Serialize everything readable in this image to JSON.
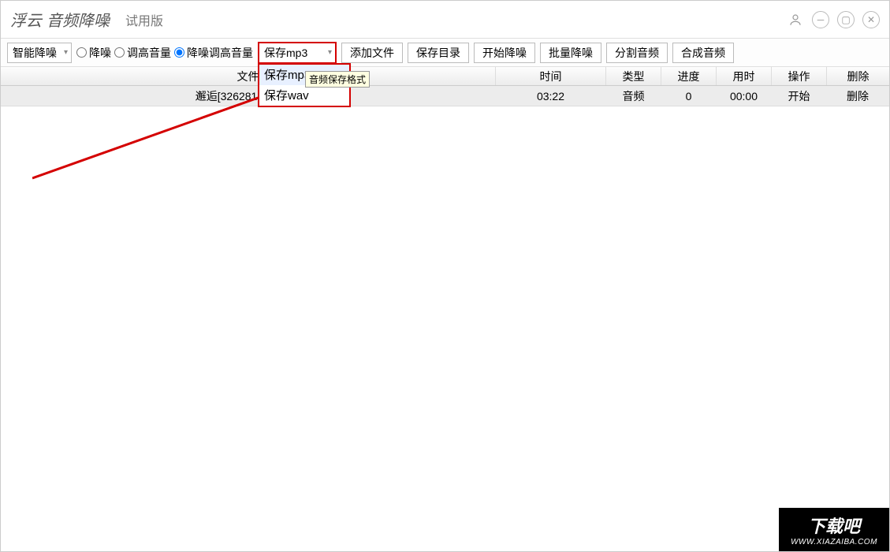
{
  "titlebar": {
    "logo": "浮云",
    "appName": "音频降噪",
    "edition": "试用版"
  },
  "toolbar": {
    "modeSelect": "智能降噪",
    "radios": {
      "r1": "降噪",
      "r2": "调高音量",
      "r3": "降噪调高音量"
    },
    "saveSelect": "保存mp3",
    "saveOptions": {
      "o1": "保存mp3",
      "o2": "保存wav"
    },
    "tooltip": "音频保存格式",
    "buttons": {
      "addFile": "添加文件",
      "saveDir": "保存目录",
      "start": "开始降噪",
      "batch": "批量降噪",
      "split": "分割音频",
      "merge": "合成音频"
    }
  },
  "table": {
    "headers": {
      "file": "文件",
      "time": "时间",
      "type": "类型",
      "progress": "进度",
      "usetime": "用时",
      "op": "操作",
      "del": "删除"
    },
    "row1": {
      "file": "邂逅[32628199] - 甫平 .mp3",
      "time": "03:22",
      "type": "音频",
      "progress": "0",
      "usetime": "00:00",
      "op": "开始",
      "del": "删除"
    }
  },
  "watermark": {
    "big": "下载吧",
    "small": "WWW.XIAZAIBA.COM"
  }
}
